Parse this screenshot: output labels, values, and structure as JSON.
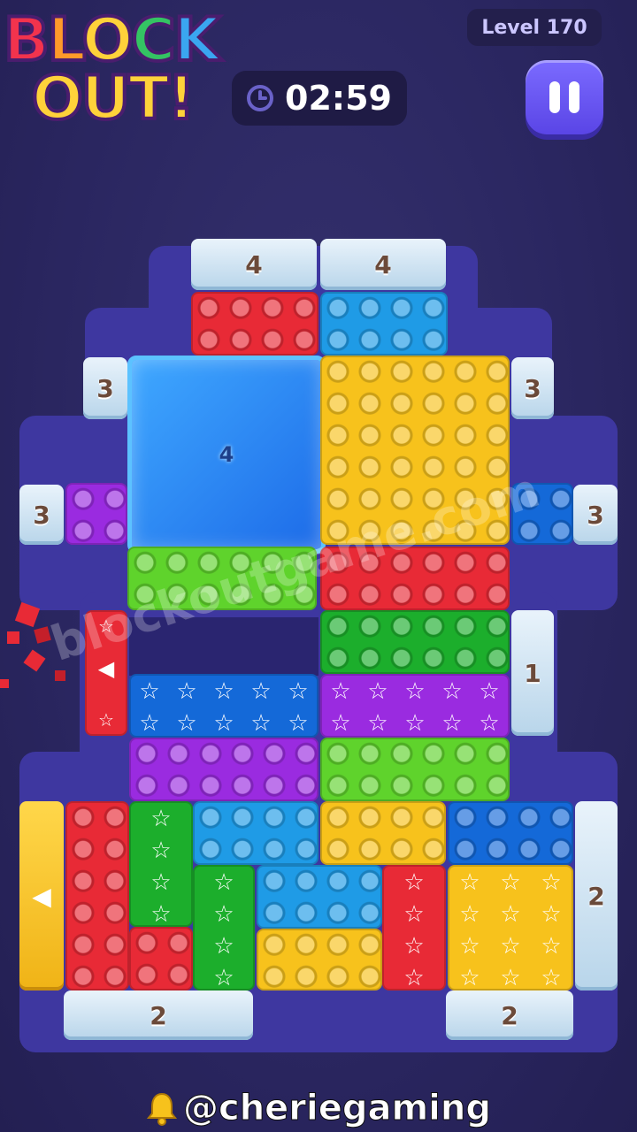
{
  "logo": {
    "line1": [
      "B",
      "L",
      "O",
      "C",
      "K"
    ],
    "line2": "OUT!"
  },
  "level": "Level 170",
  "timer": "02:59",
  "board": {
    "gates": {
      "top_left": "4",
      "top_right": "4",
      "left_upper": "3",
      "right_upper": "3",
      "left_mid": "3",
      "right_mid": "3",
      "right_lower": "1",
      "right_bottom": "2",
      "bottom_left": "2",
      "bottom_right": "2"
    },
    "ice_block_count": "4",
    "star_symbol": "☆",
    "arrow_symbol": "◀"
  },
  "watermark": "blockoutgame.com",
  "footer": "@cheriegaming"
}
